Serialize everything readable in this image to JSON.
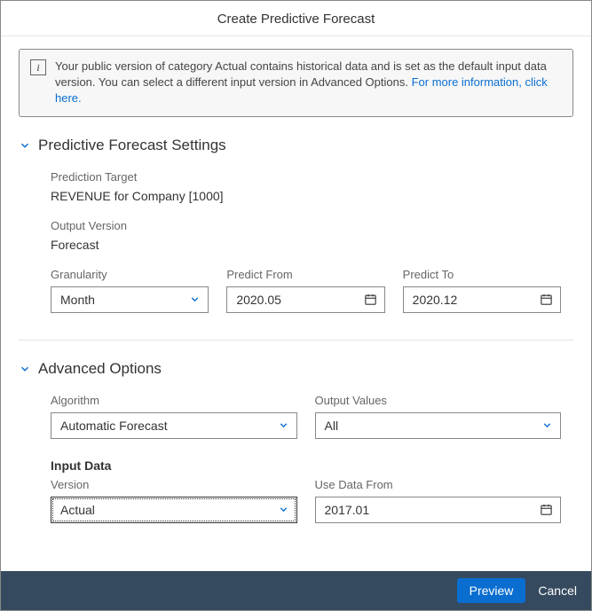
{
  "header": {
    "title": "Create Predictive Forecast"
  },
  "info": {
    "text": "Your public version of category Actual contains historical data and is set as the default input data version. You can select a different input version in Advanced Options. ",
    "link": "For more information, click here."
  },
  "settings": {
    "title": "Predictive Forecast Settings",
    "prediction_target_label": "Prediction Target",
    "prediction_target_value": "REVENUE for Company [1000]",
    "output_version_label": "Output Version",
    "output_version_value": "Forecast",
    "granularity_label": "Granularity",
    "granularity_value": "Month",
    "predict_from_label": "Predict From",
    "predict_from_value": "2020.05",
    "predict_to_label": "Predict To",
    "predict_to_value": "2020.12"
  },
  "advanced": {
    "title": "Advanced Options",
    "algorithm_label": "Algorithm",
    "algorithm_value": "Automatic Forecast",
    "output_values_label": "Output Values",
    "output_values_value": "All",
    "input_data_title": "Input Data",
    "version_label": "Version",
    "version_value": "Actual",
    "use_data_from_label": "Use Data From",
    "use_data_from_value": "2017.01"
  },
  "footer": {
    "preview": "Preview",
    "cancel": "Cancel"
  }
}
